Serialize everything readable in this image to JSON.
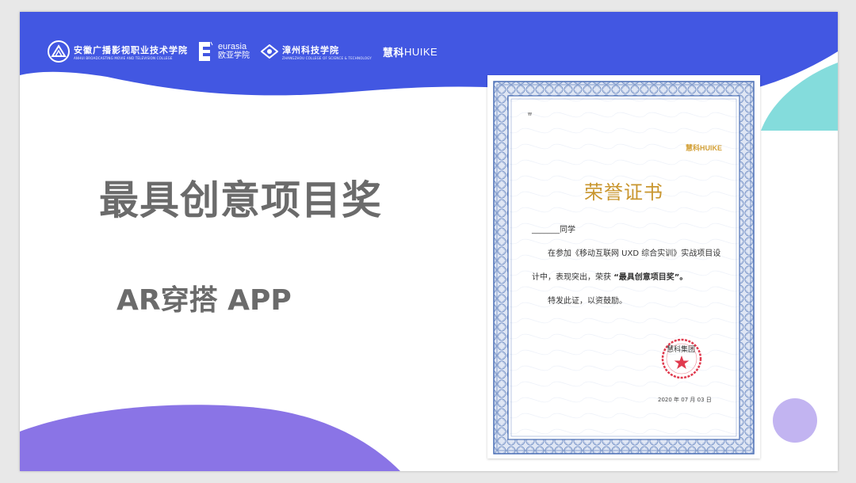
{
  "logos": {
    "college1": {
      "name": "安徽广播影视职业技术学院",
      "sub": "ANHUI BROADCASTING MOVIE AND TELEVISION COLLEGE"
    },
    "eurasia": {
      "en": "eurasia",
      "cn": "欧亚学院"
    },
    "zhangzhou": {
      "name": "漳州科技学院",
      "sub": "ZHANGZHOU COLLEGE OF SCIENCE & TECHNOLOGY"
    },
    "huike": {
      "cn": "慧科",
      "en": "HUIKE"
    }
  },
  "main": {
    "title": "最具创意项目奖",
    "subtitle": "AR穿搭 APP"
  },
  "certificate": {
    "brand": "慧科HUIKE",
    "title": "荣誉证书",
    "recipient_line": "_______同学",
    "body_line1": "在参加《移动互联网 UXD 综合实训》实战项目设",
    "body_line2_prefix": "计中，表现突出，荣获",
    "award_quoted": "“最具创意项目奖”。",
    "closing": "特发此证，以资鼓励。",
    "seal_label": "慧科集团",
    "date": "2020 年 07 月 03 日",
    "corner_mark": "₩"
  },
  "colors": {
    "blue": "#4257e2",
    "purple": "#8a74e6",
    "teal": "#84dcdc",
    "lavender": "#c2b4f1",
    "gold": "#c9962e",
    "seal_red": "#e03a4e"
  }
}
